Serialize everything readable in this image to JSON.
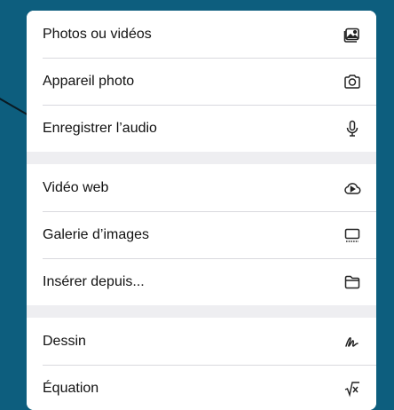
{
  "menu": {
    "group1": [
      {
        "label": "Photos ou vidéos",
        "icon": "photo-library-icon"
      },
      {
        "label": "Appareil photo",
        "icon": "camera-icon"
      },
      {
        "label": "Enregistrer l’audio",
        "icon": "microphone-icon"
      }
    ],
    "group2": [
      {
        "label": "Vidéo web",
        "icon": "cloud-play-icon"
      },
      {
        "label": "Galerie d’images",
        "icon": "image-gallery-icon"
      },
      {
        "label": "Insérer depuis...",
        "icon": "folder-icon"
      }
    ],
    "group3": [
      {
        "label": "Dessin",
        "icon": "draw-icon"
      },
      {
        "label": "Équation",
        "icon": "square-root-icon"
      }
    ]
  },
  "colors": {
    "background": "#0d5e7e",
    "menu": "#ffffff",
    "separator": "#d9d9de"
  }
}
